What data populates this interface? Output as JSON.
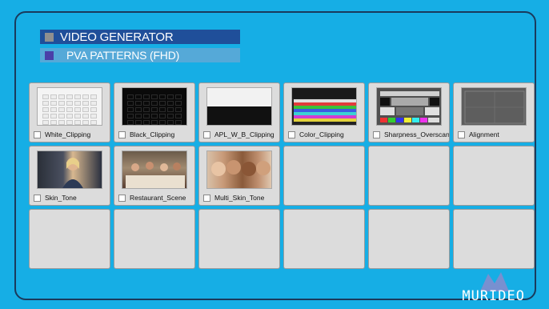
{
  "header": {
    "title": "VIDEO GENERATOR",
    "subtitle": "PVA PATTERNS (FHD)"
  },
  "tiles": [
    {
      "label": "White_Clipping",
      "thumb": "white-clipping-thumbnail"
    },
    {
      "label": "Black_Clipping",
      "thumb": "black-clipping-thumbnail"
    },
    {
      "label": "APL_W_B_Clipping",
      "thumb": "apl-thumbnail"
    },
    {
      "label": "Color_Clipping",
      "thumb": "color-clipping-thumbnail"
    },
    {
      "label": "Sharpness_Overscan",
      "thumb": "sharpness-thumbnail"
    },
    {
      "label": "Alignment",
      "thumb": "alignment-thumbnail"
    },
    {
      "label": "Skin_Tone",
      "thumb": "skin-tone-thumbnail"
    },
    {
      "label": "Restaurant_Scene",
      "thumb": "restaurant-thumbnail"
    },
    {
      "label": "Multi_Skin_Tone",
      "thumb": "multi-skin-thumbnail"
    }
  ],
  "empty_tiles": 9,
  "brand": {
    "logo_text": "MURIDEO",
    "logo_icon": "murideo-logo-icon"
  },
  "colors": {
    "background": "#16aee5",
    "header_bar": "#1f4f9a",
    "subheader_bar": "#55a9d8",
    "tile": "#dcdcdc"
  }
}
